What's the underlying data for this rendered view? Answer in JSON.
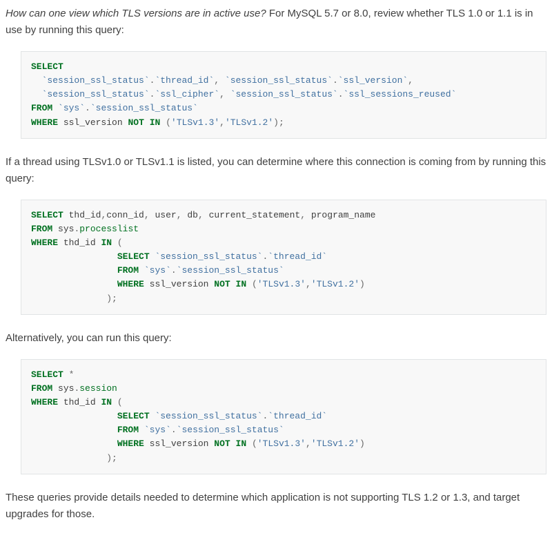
{
  "paragraphs": {
    "intro_q": "How can one view which TLS versions are in active use?",
    "intro_rest": " For MySQL 5.7 or 8.0, review whether TLS 1.0 or 1.1 is in use by running this query:",
    "p2": "If a thread using TLSv1.0 or TLSv1.1 is listed, you can determine where this connection is coming from by running this query:",
    "p3": "Alternatively, you can run this query:",
    "p4": "These queries provide details needed to determine which application is not supporting TLS 1.2 or 1.3, and target upgrades for those."
  },
  "sql": {
    "kw": {
      "select": "SELECT",
      "from": "FROM",
      "where": "WHERE",
      "not": "NOT",
      "in": "IN"
    },
    "q1": {
      "tbl": "`session_ssl_status`",
      "col_thread_id": "`thread_id`",
      "col_ssl_version": "`ssl_version`",
      "col_ssl_cipher": "`ssl_cipher`",
      "col_sessions_reused": "`ssl_sessions_reused`",
      "sys": "`sys`",
      "ssl_version_bare": "ssl_version",
      "lit_tls13": "'TLSv1.3'",
      "lit_tls12": "'TLSv1.2'"
    },
    "q2": {
      "cols": {
        "thd_id": "thd_id",
        "conn_id": "conn_id",
        "user": "user",
        "db": "db",
        "current_statement": "current_statement",
        "program_name": "program_name"
      },
      "sys": "sys",
      "processlist": "processlist"
    },
    "q3": {
      "session": "session"
    }
  }
}
